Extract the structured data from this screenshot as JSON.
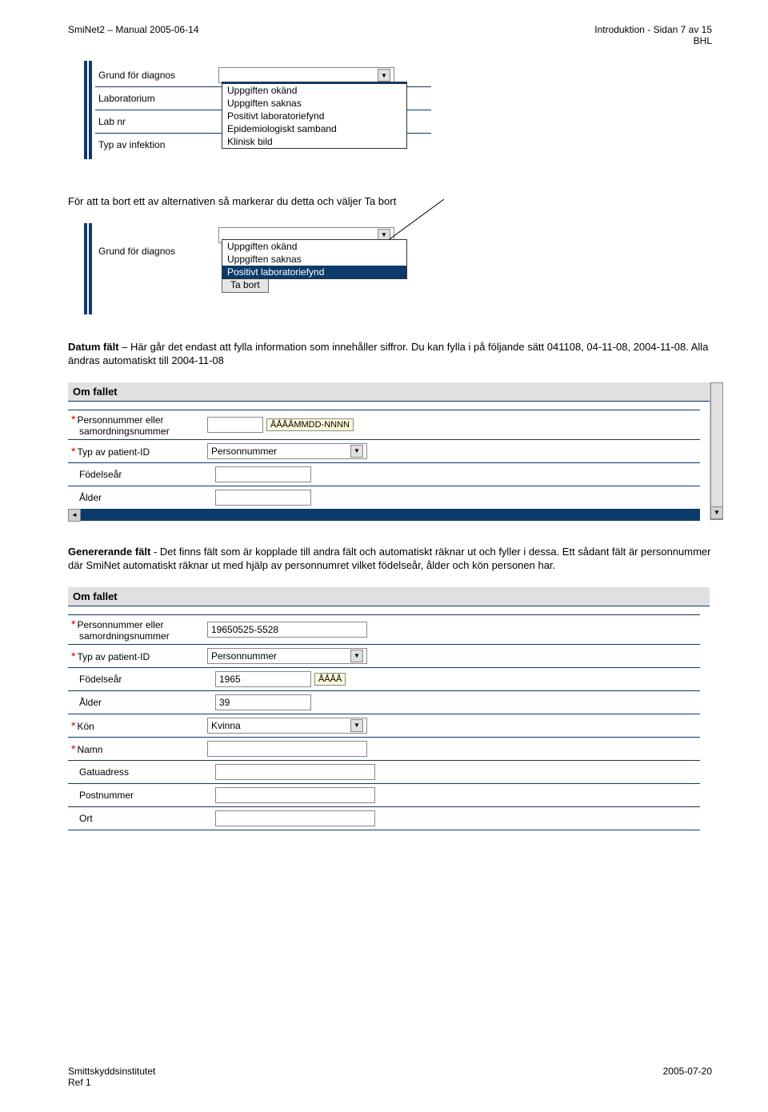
{
  "header": {
    "left": "SmiNet2 – Manual 2005-06-14",
    "right1": "Introduktion - Sidan 7 av 15",
    "right2": "BHL"
  },
  "panel1": {
    "rows": {
      "grund": "Grund för diagnos",
      "lab": "Laboratorium",
      "labnr": "Lab nr",
      "typ": "Typ av infektion"
    },
    "dropdown": {
      "opt0": "",
      "opt1": "Uppgiften okänd",
      "opt2": "Uppgiften saknas",
      "opt3": "Positivt laboratoriefynd",
      "opt4": "Epidemiologiskt samband",
      "opt5": "Klinisk bild"
    }
  },
  "para1": "För att ta bort ett av alternativen så markerar du detta och väljer Ta bort",
  "panel2": {
    "label": "Grund för diagnos",
    "dropdown": {
      "opt1": "Uppgiften okänd",
      "opt2": "Uppgiften saknas",
      "opt3": "Positivt laboratoriefynd"
    },
    "button": "Ta bort"
  },
  "para2a": "Datum fält",
  "para2b": " – Här går det endast att fylla information som innehåller siffror. Du kan fylla i på följande sätt 041108, 04-11-08, 2004-11-08. Alla ändras automatiskt till 2004-11-08",
  "panel3": {
    "head": "Om fallet",
    "rows": {
      "pnr_l1": "Personnummer eller",
      "pnr_l2": "samordningsnummer",
      "pnr_hint": "ÅÅÅÅMMDD-NNNN",
      "typid": "Typ av patient-ID",
      "typid_val": "Personnummer",
      "fodar": "Födelseår",
      "alder": "Ålder"
    }
  },
  "para3a": "Genererande fält",
  "para3b": " - Det finns fält som är kopplade till andra fält och automatiskt räknar ut och fyller i dessa. Ett sådant fält är personnummer där SmiNet automatiskt räknar ut med hjälp av personnumret vilket födelseår, ålder och kön personen har.",
  "panel4": {
    "head": "Om fallet",
    "rows": {
      "pnr_l1": "Personnummer eller",
      "pnr_l2": "samordningsnummer",
      "pnr_val": "19650525-5528",
      "typid": "Typ av patient-ID",
      "typid_val": "Personnummer",
      "fodar": "Födelseår",
      "fodar_val": "1965",
      "fodar_hint": "ÅÅÅÅ",
      "alder": "Ålder",
      "alder_val": "39",
      "kon": "Kön",
      "kon_val": "Kvinna",
      "namn": "Namn",
      "gatu": "Gatuadress",
      "postnr": "Postnummer",
      "ort": "Ort"
    }
  },
  "footer": {
    "left1": "Smittskyddsinstitutet",
    "left2": "Ref 1",
    "right": "2005-07-20"
  }
}
